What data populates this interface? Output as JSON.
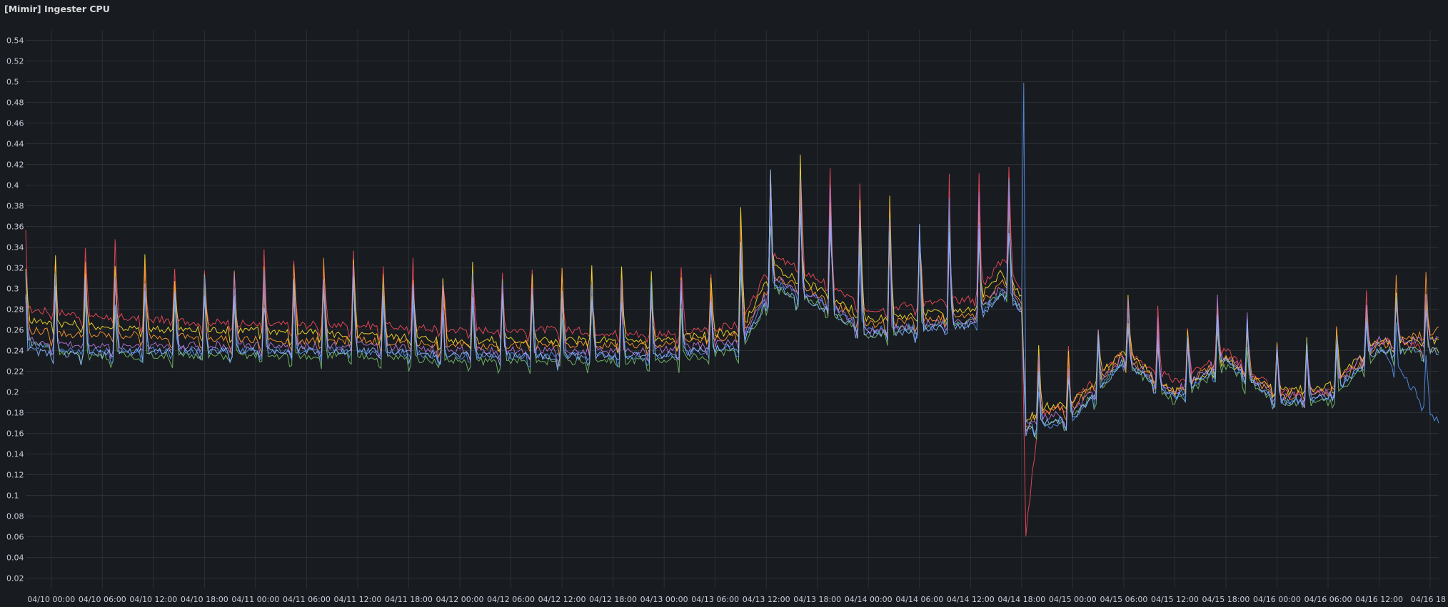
{
  "panel": {
    "title": "[Mimir] Ingester CPU"
  },
  "colors": {
    "background": "#181b1f",
    "grid": "#2c3035",
    "text": "#ccccdc"
  },
  "chart_data": {
    "type": "line",
    "title": "[Mimir] Ingester CPU",
    "xlabel": "",
    "ylabel": "",
    "ylim": [
      0.01,
      0.55
    ],
    "yticks": [
      0.02,
      0.04,
      0.06,
      0.08,
      0.1,
      0.12,
      0.14,
      0.16,
      0.18,
      0.2,
      0.22,
      0.24,
      0.26,
      0.28,
      0.3,
      0.32,
      0.34,
      0.36,
      0.38,
      0.4,
      0.42,
      0.44,
      0.46,
      0.48,
      0.5,
      0.52,
      0.54
    ],
    "ytick_labels": [
      "0.02",
      "0.04",
      "0.06",
      "0.08",
      "0.1",
      "0.12",
      "0.14",
      "0.16",
      "0.18",
      "0.2",
      "0.22",
      "0.24",
      "0.26",
      "0.28",
      "0.3",
      "0.32",
      "0.34",
      "0.36",
      "0.38",
      "0.4",
      "0.42",
      "0.44",
      "0.46",
      "0.48",
      "0.5",
      "0.52",
      "0.54"
    ],
    "xlim": [
      "04/09 21:00",
      "04/16 19:00"
    ],
    "xticks": [
      "04/10 00:00",
      "04/10 06:00",
      "04/10 12:00",
      "04/10 18:00",
      "04/11 00:00",
      "04/11 06:00",
      "04/11 12:00",
      "04/11 18:00",
      "04/12 00:00",
      "04/12 06:00",
      "04/12 12:00",
      "04/12 18:00",
      "04/13 00:00",
      "04/13 06:00",
      "04/13 12:00",
      "04/13 18:00",
      "04/14 00:00",
      "04/14 06:00",
      "04/14 12:00",
      "04/14 18:00",
      "04/15 00:00",
      "04/15 06:00",
      "04/15 12:00",
      "04/15 18:00",
      "04/16 00:00",
      "04/16 06:00",
      "04/16 12:00",
      "04/16 18"
    ],
    "grid": true,
    "legend": "none",
    "series": [
      {
        "color": "#f2495c",
        "x": [
          "04/09 21:00",
          "04/10 03:00",
          "04/10 12:00",
          "04/11 00:00",
          "04/11 12:00",
          "04/12 00:00",
          "04/12 12:00",
          "04/13 00:00",
          "04/13 09:00",
          "04/13 13:00",
          "04/13 18:00",
          "04/14 00:00",
          "04/14 12:00",
          "04/14 16:00",
          "04/14 18:00",
          "04/14 18:30",
          "04/14 20:00",
          "04/15 00:00",
          "04/15 06:00",
          "04/15 12:00",
          "04/15 18:00",
          "04/16 00:00",
          "04/16 06:00",
          "04/16 12:00",
          "04/16 19:00"
        ],
        "y": [
          0.28,
          0.275,
          0.27,
          0.265,
          0.265,
          0.26,
          0.26,
          0.255,
          0.265,
          0.33,
          0.31,
          0.28,
          0.29,
          0.33,
          0.3,
          0.06,
          0.18,
          0.19,
          0.24,
          0.21,
          0.24,
          0.2,
          0.2,
          0.25,
          0.24
        ]
      },
      {
        "color": "#fade2a",
        "x": [
          "04/09 21:00",
          "04/10 03:00",
          "04/10 12:00",
          "04/11 00:00",
          "04/11 12:00",
          "04/12 00:00",
          "04/12 12:00",
          "04/13 00:00",
          "04/13 09:00",
          "04/13 13:00",
          "04/13 18:00",
          "04/14 00:00",
          "04/14 12:00",
          "04/14 16:00",
          "04/14 18:00",
          "04/14 18:30",
          "04/14 20:00",
          "04/15 00:00",
          "04/15 06:00",
          "04/15 12:00",
          "04/15 18:00",
          "04/16 00:00",
          "04/16 06:00",
          "04/16 12:00",
          "04/16 19:00"
        ],
        "y": [
          0.27,
          0.265,
          0.26,
          0.26,
          0.255,
          0.25,
          0.25,
          0.25,
          0.26,
          0.32,
          0.3,
          0.27,
          0.28,
          0.32,
          0.29,
          0.17,
          0.185,
          0.19,
          0.24,
          0.2,
          0.23,
          0.2,
          0.205,
          0.25,
          0.25
        ]
      },
      {
        "color": "#ff9830",
        "x": [
          "04/09 21:00",
          "04/10 03:00",
          "04/10 12:00",
          "04/11 00:00",
          "04/11 12:00",
          "04/12 00:00",
          "04/12 12:00",
          "04/13 00:00",
          "04/13 09:00",
          "04/13 13:00",
          "04/13 18:00",
          "04/14 00:00",
          "04/14 12:00",
          "04/14 16:00",
          "04/14 18:00",
          "04/14 18:30",
          "04/14 20:00",
          "04/15 00:00",
          "04/15 06:00",
          "04/15 12:00",
          "04/15 18:00",
          "04/16 00:00",
          "04/16 06:00",
          "04/16 12:00",
          "04/16 19:00"
        ],
        "y": [
          0.26,
          0.255,
          0.255,
          0.25,
          0.25,
          0.245,
          0.245,
          0.245,
          0.255,
          0.31,
          0.295,
          0.265,
          0.275,
          0.31,
          0.285,
          0.165,
          0.18,
          0.185,
          0.235,
          0.2,
          0.235,
          0.195,
          0.2,
          0.245,
          0.26
        ]
      },
      {
        "color": "#73bf69",
        "x": [
          "04/09 21:00",
          "04/10 03:00",
          "04/10 12:00",
          "04/11 00:00",
          "04/11 12:00",
          "04/12 00:00",
          "04/12 12:00",
          "04/13 00:00",
          "04/13 09:00",
          "04/13 13:00",
          "04/13 18:00",
          "04/14 00:00",
          "04/14 12:00",
          "04/14 16:00",
          "04/14 18:00",
          "04/14 18:30",
          "04/14 20:00",
          "04/15 00:00",
          "04/15 06:00",
          "04/15 12:00",
          "04/15 18:00",
          "04/16 00:00",
          "04/16 06:00",
          "04/16 12:00",
          "04/16 19:00"
        ],
        "y": [
          0.25,
          0.235,
          0.235,
          0.235,
          0.235,
          0.23,
          0.23,
          0.23,
          0.24,
          0.3,
          0.285,
          0.255,
          0.27,
          0.3,
          0.28,
          0.16,
          0.17,
          0.175,
          0.23,
          0.19,
          0.225,
          0.19,
          0.19,
          0.24,
          0.24
        ]
      },
      {
        "color": "#5794f2",
        "x": [
          "04/09 21:00",
          "04/10 03:00",
          "04/10 12:00",
          "04/11 00:00",
          "04/11 12:00",
          "04/12 00:00",
          "04/12 12:00",
          "04/13 00:00",
          "04/13 09:00",
          "04/13 13:00",
          "04/13 18:00",
          "04/14 00:00",
          "04/14 12:00",
          "04/14 16:00",
          "04/14 18:00",
          "04/14 18:15",
          "04/14 18:30",
          "04/14 20:00",
          "04/15 00:00",
          "04/15 06:00",
          "04/15 12:00",
          "04/15 18:00",
          "04/16 00:00",
          "04/16 06:00",
          "04/16 12:00",
          "04/16 19:00"
        ],
        "y": [
          0.245,
          0.24,
          0.24,
          0.24,
          0.24,
          0.235,
          0.235,
          0.235,
          0.245,
          0.305,
          0.29,
          0.26,
          0.265,
          0.3,
          0.28,
          0.5,
          0.17,
          0.165,
          0.175,
          0.23,
          0.195,
          0.23,
          0.19,
          0.195,
          0.245,
          0.17
        ]
      },
      {
        "color": "#b877d9",
        "x": [
          "04/09 21:00",
          "04/10 03:00",
          "04/10 12:00",
          "04/11 00:00",
          "04/11 12:00",
          "04/12 00:00",
          "04/12 12:00",
          "04/13 00:00",
          "04/13 09:00",
          "04/13 13:00",
          "04/13 18:00",
          "04/14 00:00",
          "04/14 12:00",
          "04/14 16:00",
          "04/14 18:00",
          "04/14 18:30",
          "04/14 20:00",
          "04/15 00:00",
          "04/15 06:00",
          "04/15 12:00",
          "04/15 18:00",
          "04/16 00:00",
          "04/16 06:00",
          "04/16 12:00",
          "04/16 19:00"
        ],
        "y": [
          0.25,
          0.245,
          0.245,
          0.245,
          0.245,
          0.24,
          0.24,
          0.24,
          0.25,
          0.31,
          0.29,
          0.26,
          0.27,
          0.305,
          0.28,
          0.165,
          0.175,
          0.18,
          0.235,
          0.2,
          0.235,
          0.195,
          0.2,
          0.25,
          0.25
        ]
      },
      {
        "color": "#8ab8ff",
        "x": [
          "04/09 21:00",
          "04/10 03:00",
          "04/10 12:00",
          "04/11 00:00",
          "04/11 12:00",
          "04/12 00:00",
          "04/12 12:00",
          "04/13 00:00",
          "04/13 09:00",
          "04/13 13:00",
          "04/13 18:00",
          "04/14 00:00",
          "04/14 12:00",
          "04/14 16:00",
          "04/14 18:00",
          "04/14 18:30",
          "04/14 20:00",
          "04/15 00:00",
          "04/15 06:00",
          "04/15 12:00",
          "04/15 18:00",
          "04/16 00:00",
          "04/16 06:00",
          "04/16 12:00",
          "04/16 19:00"
        ],
        "y": [
          0.24,
          0.235,
          0.24,
          0.24,
          0.24,
          0.235,
          0.235,
          0.235,
          0.245,
          0.3,
          0.285,
          0.255,
          0.265,
          0.295,
          0.275,
          0.16,
          0.17,
          0.175,
          0.23,
          0.195,
          0.23,
          0.19,
          0.195,
          0.24,
          0.24
        ]
      }
    ]
  }
}
